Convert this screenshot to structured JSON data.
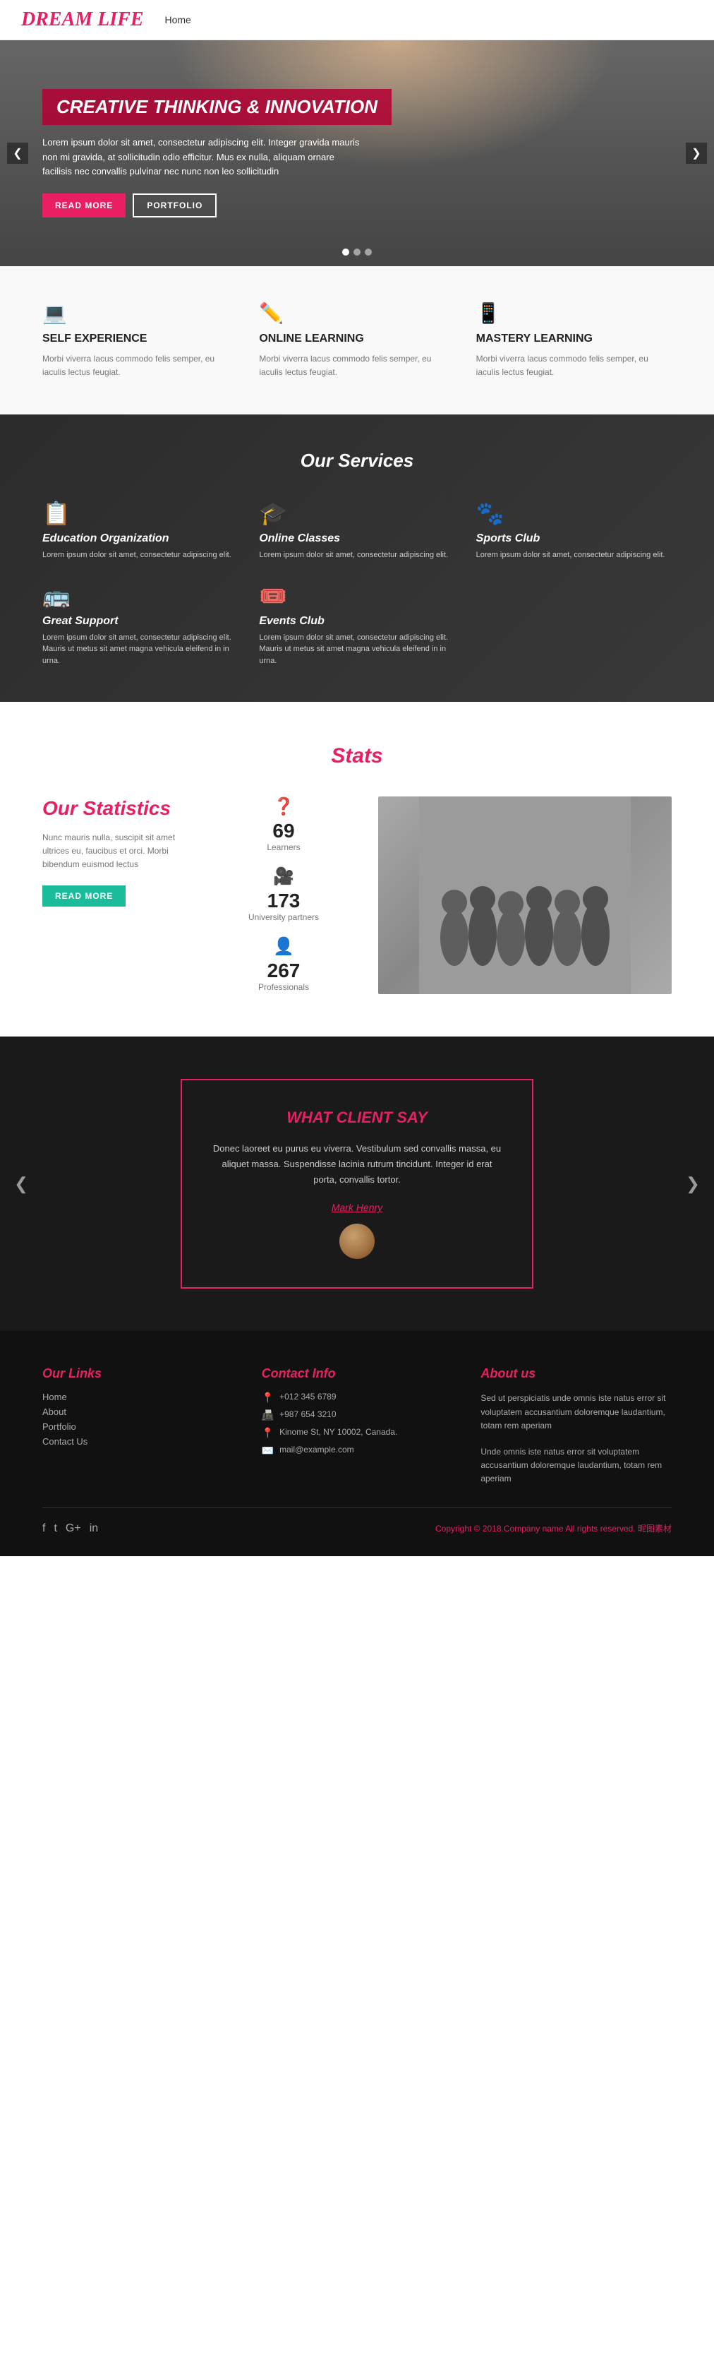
{
  "header": {
    "logo": "DREAM LIFE",
    "nav": [
      "Home"
    ]
  },
  "hero": {
    "title": "CREATIVE THINKING & INNOVATION",
    "text": "Lorem ipsum dolor sit amet, consectetur adipiscing elit. Integer gravida mauris non mi gravida, at sollicitudin odio efficitur. Mus ex nulla, aliquam ornare facilisis nec convallis pulvinar nec nunc non leo sollicitudin",
    "btn_read": "READ MORE",
    "btn_portfolio": "PORTFOLIO",
    "dots": 3
  },
  "features": [
    {
      "icon": "💻",
      "title": "SELF EXPERIENCE",
      "text": "Morbi viverra lacus commodo felis semper, eu iaculis lectus feugiat."
    },
    {
      "icon": "✏️",
      "title": "ONLINE LEARNING",
      "text": "Morbi viverra lacus commodo felis semper, eu iaculis lectus feugiat."
    },
    {
      "icon": "📱",
      "title": "MASTERY LEARNING",
      "text": "Morbi viverra lacus commodo felis semper, eu iaculis lectus feugiat."
    }
  ],
  "services": {
    "title": "Our Services",
    "items": [
      {
        "icon": "📋",
        "icon_color": "yellow",
        "name": "Education Organization",
        "text": "Lorem ipsum dolor sit amet, consectetur adipiscing elit."
      },
      {
        "icon": "🎓",
        "icon_color": "pink",
        "name": "Online Classes",
        "text": "Lorem ipsum dolor sit amet, consectetur adipiscing elit."
      },
      {
        "icon": "🐾",
        "icon_color": "green",
        "name": "Sports Club",
        "text": "Lorem ipsum dolor sit amet, consectetur adipiscing elit."
      },
      {
        "icon": "🚌",
        "icon_color": "blue",
        "name": "Great Support",
        "text": "Lorem ipsum dolor sit amet, consectetur adipiscing elit. Mauris ut metus sit amet magna vehicula eleifend in in urna."
      },
      {
        "icon": "🎟️",
        "icon_color": "teal",
        "name": "Events Club",
        "text": "Lorem ipsum dolor sit amet, consectetur adipiscing elit. Mauris ut metus sit amet magna vehicula eleifend in in urna."
      }
    ]
  },
  "stats": {
    "section_title": "Stats",
    "left_title": "Our Statistics",
    "left_text": "Nunc mauris nulla, suscipit sit amet ultrices eu, faucibus et orci. Morbi bibendum euismod lectus",
    "btn_label": "READ MORE",
    "items": [
      {
        "icon": "❓",
        "number": "69",
        "label": "Learners"
      },
      {
        "icon": "🎥",
        "number": "173",
        "label": "University partners"
      },
      {
        "icon": "👤",
        "number": "267",
        "label": "Professionals"
      }
    ]
  },
  "testimonial": {
    "title": "WHAT CLIENT SAY",
    "text": "Donec laoreet eu purus eu viverra. Vestibulum sed convallis massa, eu aliquet massa. Suspendisse lacinia rutrum tincidunt. Integer id erat porta, convallis tortor.",
    "author": "Mark Henry"
  },
  "footer": {
    "links_title": "Our Links",
    "links": [
      "Home",
      "About",
      "Portfolio",
      "Contact Us"
    ],
    "contact_title": "Contact Info",
    "contact_items": [
      {
        "icon": "📍",
        "text": "+012 345 6789"
      },
      {
        "icon": "📠",
        "text": "+987 654 3210"
      },
      {
        "icon": "📍",
        "text": "Kinome St, NY 10002, Canada."
      },
      {
        "icon": "✉️",
        "text": "mail@example.com"
      }
    ],
    "about_title": "About us",
    "about_text": "Sed ut perspiciatis unde omnis iste natus error sit voluptatem accusantium doloremque laudantium, totam rem aperiam\n\nUnde omnis iste natus error sit voluptatem accusantium doloremque laudantium, totam rem aperiam",
    "socials": [
      "f",
      "t",
      "G+",
      "in"
    ],
    "copyright": "Copyright © 2018.Company name All rights reserved."
  }
}
